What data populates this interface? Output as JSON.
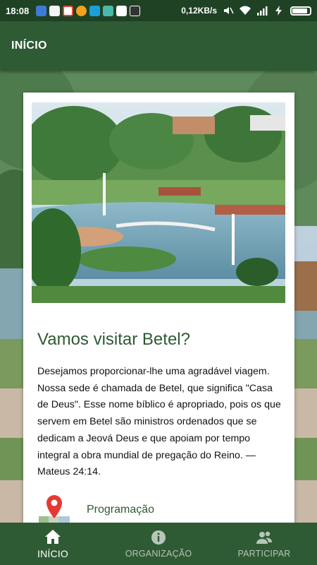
{
  "status_bar": {
    "time": "18:08",
    "network_speed": "0,12KB/s",
    "notification_icons": [
      "app-icon",
      "app-icon",
      "google-icon",
      "app-icon",
      "app-icon",
      "app-icon",
      "app-icon",
      "app-icon"
    ],
    "system_icons": [
      "mute-icon",
      "wifi-icon",
      "signal-icon",
      "charging-icon",
      "battery-icon"
    ]
  },
  "app_bar": {
    "title": "INÍCIO"
  },
  "card": {
    "title": "Vamos visitar Betel?",
    "body": "Desejamos proporcionar-lhe uma agradável viagem. Nossa sede é chamada de Betel, que significa \"Casa de Deus\". Esse nome bíblico é apropriado, pois os que servem em Betel são ministros ordenados que se dedicam a Jeová Deus e que apoiam por tempo integral a obra mundial de pregação do Reino. — Mateus 24:14.",
    "section_label": "Programação",
    "section_icon": "map-pin-icon"
  },
  "bottom_nav": {
    "items": [
      {
        "label": "INÍCIO",
        "icon": "home-icon",
        "active": true
      },
      {
        "label": "ORGANIZAÇÃO",
        "icon": "info-icon",
        "active": false
      },
      {
        "label": "PARTICIPAR",
        "icon": "people-icon",
        "active": false
      }
    ]
  },
  "colors": {
    "primary": "#2e5a34",
    "status_bar": "#1f4225",
    "nav_inactive": "#b7c6b8",
    "accent_red": "#e53935"
  }
}
